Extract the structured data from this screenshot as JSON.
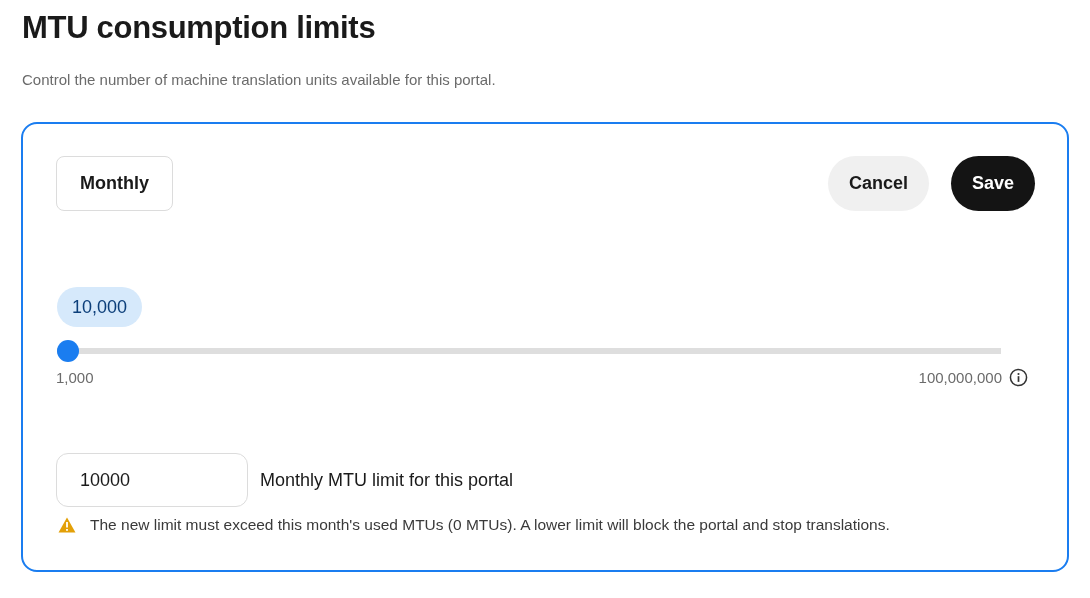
{
  "title": "MTU consumption limits",
  "subtitle": "Control the number of machine translation units available for this portal.",
  "period_button": "Monthly",
  "buttons": [
    {
      "label": "Cancel",
      "kind": "secondary"
    },
    {
      "label": "Save",
      "kind": "primary"
    }
  ],
  "slider": {
    "value_badge": "10,000",
    "level": 0,
    "min_label": "1,000",
    "max_label": "100,000,000"
  },
  "limit_field": {
    "value": "10000",
    "label": "Monthly MTU limit for this portal"
  },
  "warning": "The new limit must exceed this month's used MTUs (0 MTUs). A lower limit will block the portal and stop translations."
}
